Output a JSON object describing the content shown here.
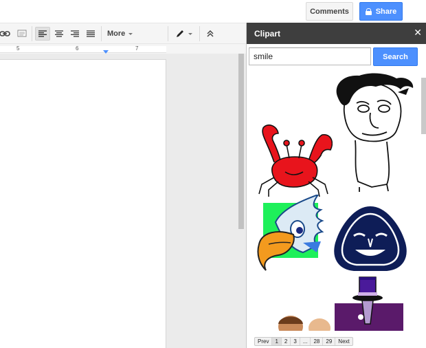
{
  "header": {
    "comments_label": "Comments",
    "share_label": "Share",
    "share_icon": "lock-icon",
    "accent": "#4d90fe"
  },
  "toolbar": {
    "icons": [
      "link-icon",
      "insert-comment-icon",
      "align-left-icon",
      "align-center-icon",
      "align-right-icon",
      "align-justify-icon",
      "pen-icon",
      "collapse-icon"
    ],
    "more_label": "More"
  },
  "ruler": {
    "numbers": [
      "5",
      "6",
      "7"
    ]
  },
  "clipart": {
    "title": "Clipart",
    "close_icon": "close-icon",
    "search_value": "smile",
    "search_label": "Search",
    "results": [
      "crab-clipart",
      "face-sketch-clipart",
      "bird-clipart",
      "smiling-mask-clipart",
      "person-clipart",
      "top-hat-clipart"
    ],
    "pager": {
      "prev": "Prev",
      "pages": [
        "1",
        "2",
        "3",
        "...",
        "28",
        "29"
      ],
      "next": "Next",
      "current": "1"
    }
  }
}
